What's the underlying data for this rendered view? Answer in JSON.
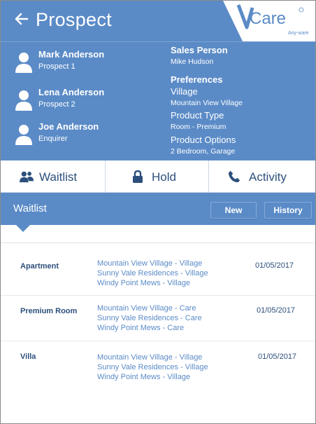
{
  "header": {
    "title": "Prospect",
    "logo_text": "Care",
    "logo_tagline": "Any-ware",
    "brand_color": "#5b8bc7"
  },
  "prospects": [
    {
      "name": "Mark Anderson",
      "role": "Prospect 1"
    },
    {
      "name": "Lena Anderson",
      "role": "Prospect 2"
    },
    {
      "name": "Joe Anderson",
      "role": "Enquirer"
    }
  ],
  "details": {
    "sales_person_label": "Sales Person",
    "sales_person": "Mike Hudson",
    "preferences_label": "Preferences",
    "village_label": "Village",
    "village": "Mountain View Village",
    "product_type_label": "Product Type",
    "product_type": "Room - Premium",
    "product_options_label": "Product Options",
    "product_options": "2 Bedroom, Garage"
  },
  "tabs": [
    {
      "label": "Waitlist",
      "icon": "people-icon"
    },
    {
      "label": "Hold",
      "icon": "lock-icon"
    },
    {
      "label": "Activity",
      "icon": "phone-icon"
    }
  ],
  "waitlist": {
    "title": "Waitlist",
    "new_label": "New",
    "history_label": "History",
    "rows": [
      {
        "type": "Apartment",
        "locations": [
          "Mountain View Village - Village",
          "Sunny Vale Residences - Village",
          "Windy Point Mews - Village"
        ],
        "date": "01/05/2017"
      },
      {
        "type": "Premium Room",
        "locations": [
          "Mountain View Village - Care",
          "Sunny Vale Residences - Care",
          "Windy Point Mews - Care"
        ],
        "date": "01/05/2017"
      },
      {
        "type": "Villa",
        "locations": [
          "Mountain View Village - Village",
          "Sunny Vale Residences - Village",
          "Windy Point Mews - Village"
        ],
        "date": "01/05/2017"
      }
    ]
  }
}
